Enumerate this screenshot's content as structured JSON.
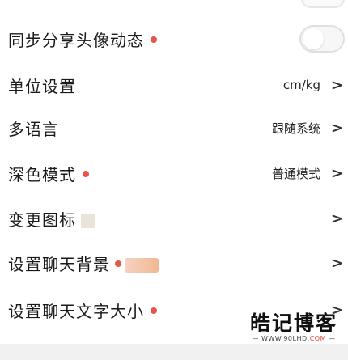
{
  "rows": [
    {
      "label": "同步分享头像动态",
      "has_dot": true,
      "control": "toggle",
      "toggle_on": false
    },
    {
      "label": "单位设置",
      "value": "cm/kg"
    },
    {
      "label": "多语言",
      "value": "跟随系统"
    },
    {
      "label": "深色模式",
      "has_dot": true,
      "value": "普通模式"
    },
    {
      "label": "变更图标"
    },
    {
      "label": "设置聊天背景",
      "has_dot": true
    },
    {
      "label": "设置聊天文字大小",
      "has_dot": true
    }
  ],
  "chevron": ">",
  "watermark": {
    "title": "皓记博客",
    "sub_prefix": "— WWW.90LHD.",
    "sub_accent": "COM",
    "sub_suffix": " —"
  },
  "colors": {
    "dot": "#e5554a",
    "background": "#ffffff",
    "text": "#1a1a1a"
  }
}
